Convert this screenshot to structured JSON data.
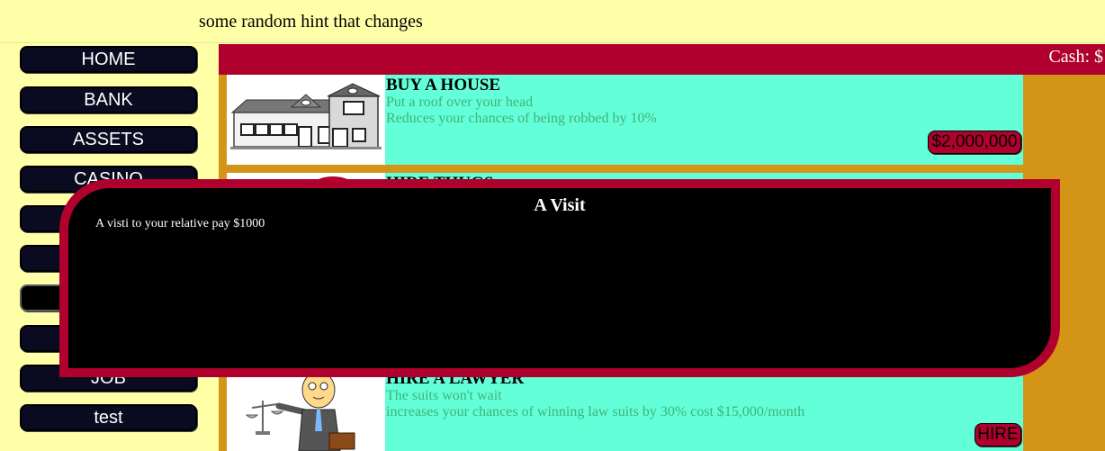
{
  "hint": "some random hint that changes",
  "sidebar": {
    "items": [
      {
        "label": "HOME"
      },
      {
        "label": "BANK"
      },
      {
        "label": "ASSETS"
      },
      {
        "label": "CASINO"
      },
      {
        "label": ""
      },
      {
        "label": ""
      },
      {
        "label": ""
      },
      {
        "label": ""
      },
      {
        "label": "JOB"
      },
      {
        "label": "test"
      }
    ]
  },
  "header": {
    "cash_label": "Cash: $"
  },
  "cards": [
    {
      "title": "BUY A HOUSE",
      "subtitle": "Put a roof over your head",
      "description": "Reduces your chances of being robbed by 10%",
      "button": "$2,000,000",
      "image_icon": "house-icon"
    },
    {
      "title": "HIRE THUGS",
      "subtitle": "",
      "description": "",
      "button": "",
      "image_icon": "thug-icon"
    },
    {
      "title": "HIRE A LAWYER",
      "subtitle": "The suits won't wait",
      "description": "increases your chances of winning law suits by 30% cost $15,000/month",
      "button": "HIRE",
      "image_icon": "lawyer-icon"
    }
  ],
  "modal": {
    "title": "A Visit",
    "body": "A visti to your relative pay $1000"
  },
  "colors": {
    "background": "#ffffa8",
    "accent": "#b0002e",
    "panel": "#d49416",
    "card": "#63ffd8",
    "button": "#0a0a20"
  }
}
